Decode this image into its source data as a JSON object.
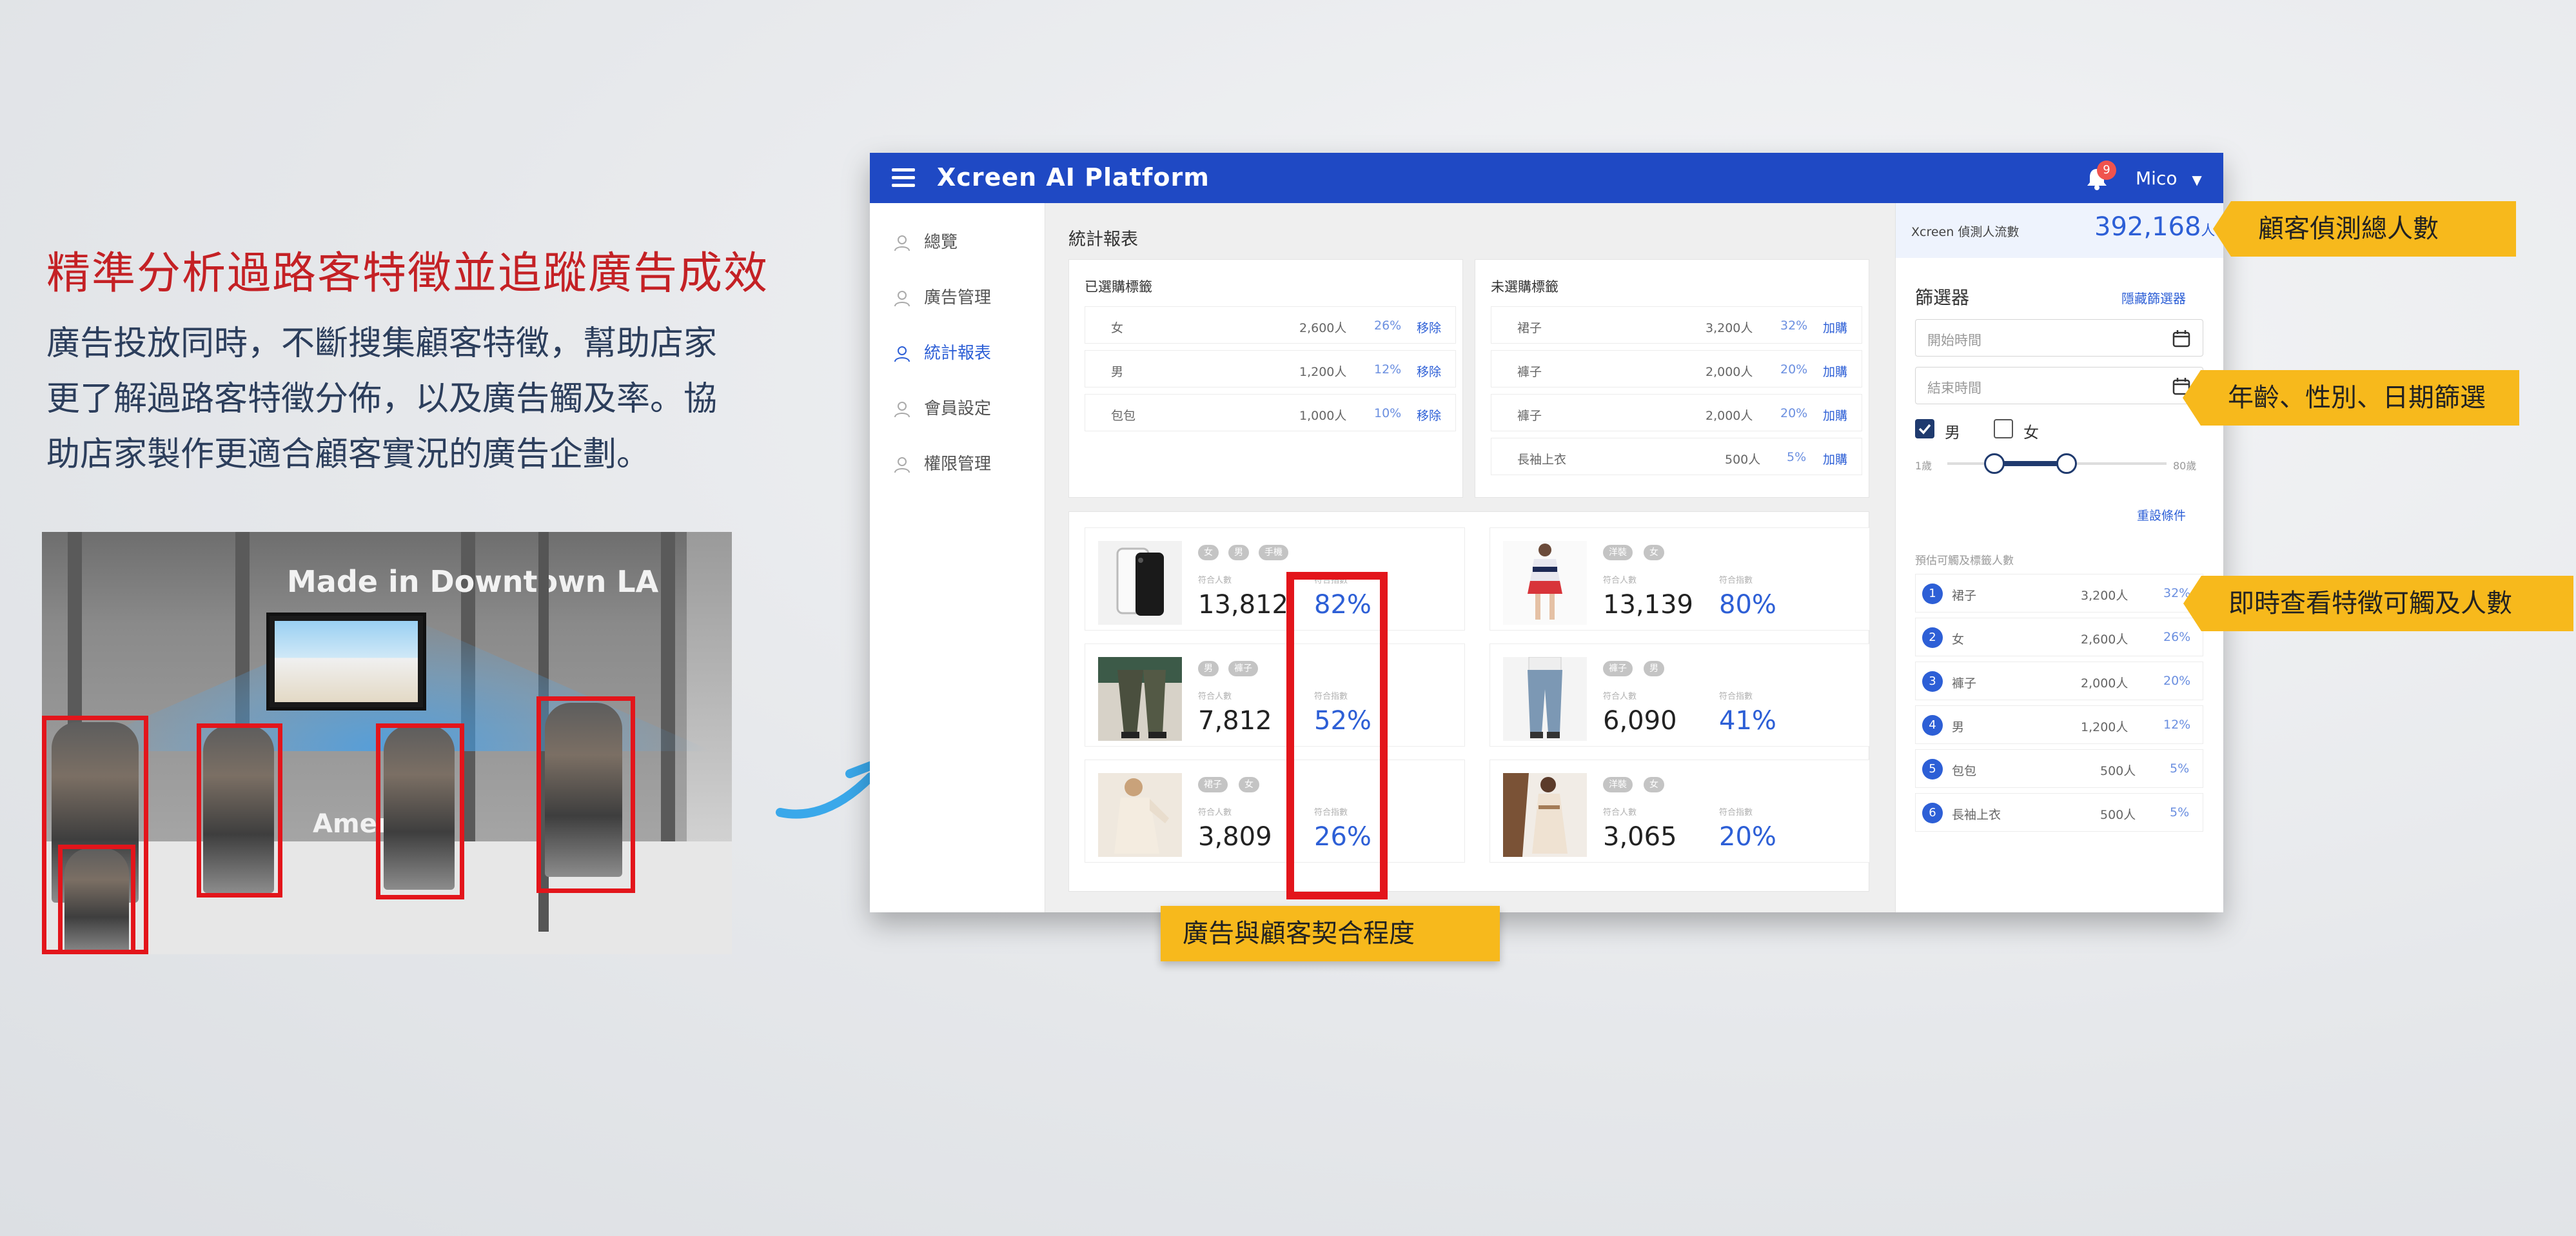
{
  "headline": "精準分析過路客特徵並追蹤廣告成效",
  "paragraph_lines": [
    "廣告投放同時，不斷搜集顧客特徵，幫助店家",
    "更了解過路客特徵分佈，以及廣告觸及率。協",
    "助店家製作更適合顧客實況的廣告企劃。"
  ],
  "photo": {
    "sign_top": "Made in Downtown LA",
    "sign_bottom": "Amer"
  },
  "app": {
    "title": "Xcreen AI Platform",
    "notification_count": "9",
    "user_name": "Mico",
    "nav": [
      {
        "label": "總覽"
      },
      {
        "label": "廣告管理"
      },
      {
        "label": "統計報表"
      },
      {
        "label": "會員設定"
      },
      {
        "label": "權限管理"
      }
    ],
    "page_title": "統計報表",
    "selected_tags": {
      "title": "已選購標籤",
      "rows": [
        {
          "label": "女",
          "count": "2,600人",
          "pct": "26%",
          "action": "移除"
        },
        {
          "label": "男",
          "count": "1,200人",
          "pct": "12%",
          "action": "移除"
        },
        {
          "label": "包包",
          "count": "1,000人",
          "pct": "10%",
          "action": "移除"
        }
      ]
    },
    "unselected_tags": {
      "title": "未選購標籤",
      "rows": [
        {
          "label": "裙子",
          "count": "3,200人",
          "pct": "32%",
          "action": "加購"
        },
        {
          "label": "褲子",
          "count": "2,000人",
          "pct": "20%",
          "action": "加購"
        },
        {
          "label": "褲子",
          "count": "2,000人",
          "pct": "20%",
          "action": "加購"
        },
        {
          "label": "長袖上衣",
          "count": "500人",
          "pct": "5%",
          "action": "加購"
        }
      ]
    },
    "ads": [
      {
        "tags": [
          "女",
          "男",
          "手機"
        ],
        "count_label": "符合人數",
        "count": "13,812",
        "index_label": "符合指數",
        "index": "82%"
      },
      {
        "tags": [
          "洋裝",
          "女"
        ],
        "count_label": "符合人數",
        "count": "13,139",
        "index_label": "符合指數",
        "index": "80%"
      },
      {
        "tags": [
          "男",
          "褲子"
        ],
        "count_label": "符合人數",
        "count": "7,812",
        "index_label": "符合指數",
        "index": "52%"
      },
      {
        "tags": [
          "褲子",
          "男"
        ],
        "count_label": "符合人數",
        "count": "6,090",
        "index_label": "符合指數",
        "index": "41%"
      },
      {
        "tags": [
          "裙子",
          "女"
        ],
        "count_label": "符合人數",
        "count": "3,809",
        "index_label": "符合指數",
        "index": "26%"
      },
      {
        "tags": [
          "洋裝",
          "女"
        ],
        "count_label": "符合人數",
        "count": "3,065",
        "index_label": "符合指數",
        "index": "20%"
      }
    ],
    "right": {
      "detect_label": "Xcreen 偵測人流數",
      "detect_value": "392,168",
      "detect_unit": "人",
      "filter_title": "篩選器",
      "hide_filter": "隱藏篩選器",
      "start_placeholder": "開始時間",
      "end_placeholder": "結束時間",
      "male_label": "男",
      "male_checked": true,
      "female_label": "女",
      "female_checked": false,
      "age_min_label": "1歲",
      "age_max_label": "80歲",
      "age_range": [
        18,
        44
      ],
      "reset_label": "重設條件",
      "reach_title": "預估可觸及標籤人數",
      "ranking": [
        {
          "rank": "1",
          "label": "裙子",
          "count": "3,200人",
          "pct": "32%"
        },
        {
          "rank": "2",
          "label": "女",
          "count": "2,600人",
          "pct": "26%"
        },
        {
          "rank": "3",
          "label": "褲子",
          "count": "2,000人",
          "pct": "20%"
        },
        {
          "rank": "4",
          "label": "男",
          "count": "1,200人",
          "pct": "12%"
        },
        {
          "rank": "5",
          "label": "包包",
          "count": "500人",
          "pct": "5%"
        },
        {
          "rank": "6",
          "label": "長袖上衣",
          "count": "500人",
          "pct": "5%"
        }
      ]
    }
  },
  "callouts": {
    "total_detect": "顧客偵測總人數",
    "filters": "年齡、性別、日期篩選",
    "reach": "即時查看特徵可觸及人數",
    "fit": "廣告與顧客契合程度"
  },
  "colors": {
    "brand_blue": "#1f49c4",
    "accent_blue": "#2d5fd6",
    "callout_yellow": "#f7b91c",
    "highlight_red": "#e3151b",
    "headline_red": "#c42125"
  }
}
